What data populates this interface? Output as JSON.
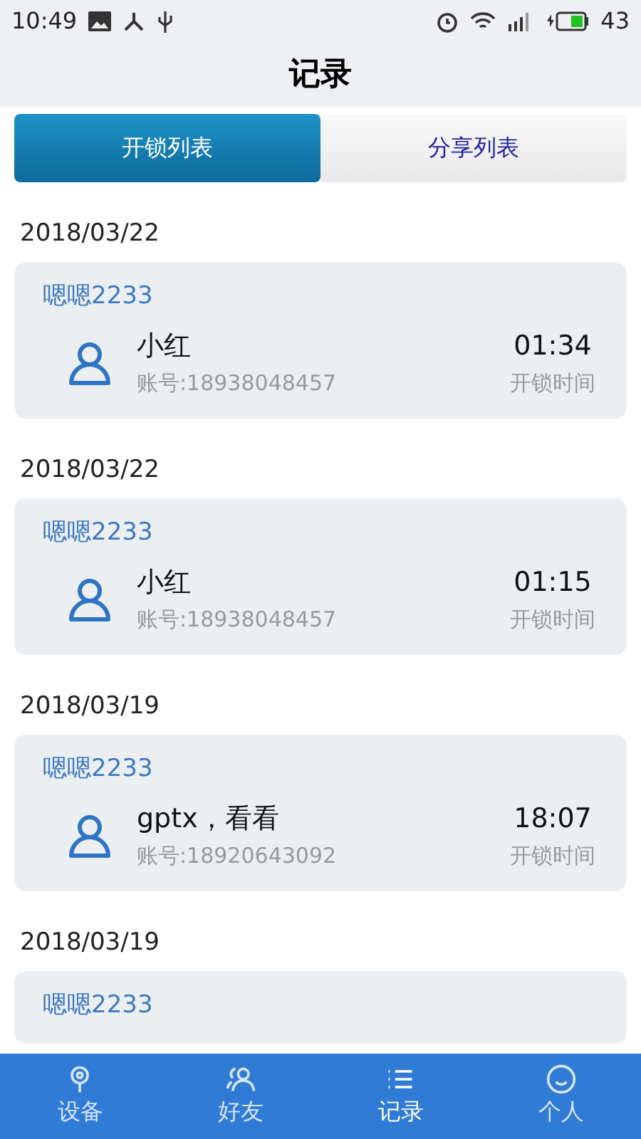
{
  "status_bar": {
    "time": "10:49",
    "battery": "43"
  },
  "header": {
    "title": "记录"
  },
  "tabs": [
    {
      "label": "开锁列表",
      "selected": true
    },
    {
      "label": "分享列表",
      "selected": false
    }
  ],
  "records": [
    {
      "date": "2018/03/22",
      "device": "嗯嗯2233",
      "name": "小红",
      "account": "账号:18938048457",
      "time": "01:34",
      "time_label": "开锁时间"
    },
    {
      "date": "2018/03/22",
      "device": "嗯嗯2233",
      "name": "小红",
      "account": "账号:18938048457",
      "time": "01:15",
      "time_label": "开锁时间"
    },
    {
      "date": "2018/03/19",
      "device": "嗯嗯2233",
      "name": "gptx，看看",
      "account": "账号:18920643092",
      "time": "18:07",
      "time_label": "开锁时间"
    },
    {
      "date": "2018/03/19",
      "device": "嗯嗯2233"
    }
  ],
  "nav": [
    {
      "kind": "pin",
      "label": "设备",
      "selected": false
    },
    {
      "kind": "friends",
      "label": "好友",
      "selected": false
    },
    {
      "kind": "list",
      "label": "记录",
      "selected": true
    },
    {
      "kind": "smile",
      "label": "个人",
      "selected": false
    }
  ]
}
